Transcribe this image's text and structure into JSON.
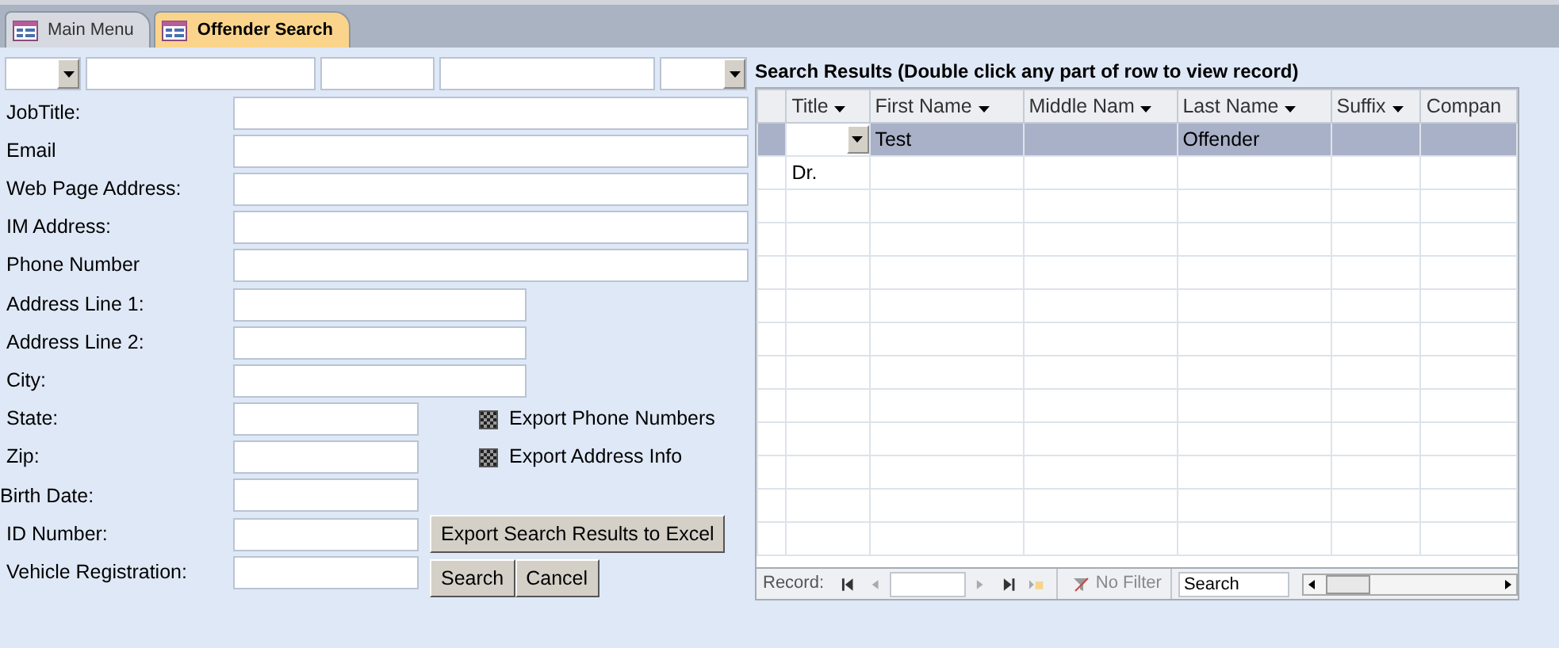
{
  "tabs": [
    {
      "label": "Main Menu",
      "selected": false
    },
    {
      "label": "Offender Search",
      "selected": true
    }
  ],
  "top_fields": [
    {
      "kind": "combo"
    },
    {
      "kind": "text"
    },
    {
      "kind": "text"
    },
    {
      "kind": "text"
    },
    {
      "kind": "combo"
    }
  ],
  "fields": [
    {
      "label": "JobTitle:",
      "kind": "long"
    },
    {
      "label": "Email",
      "kind": "long"
    },
    {
      "label": "Web Page Address:",
      "kind": "long"
    },
    {
      "label": "IM Address:",
      "kind": "long"
    },
    {
      "label": "Phone Number",
      "kind": "long"
    },
    {
      "label": "Address Line 1:",
      "kind": "medium"
    },
    {
      "label": "Address Line 2:",
      "kind": "medium"
    },
    {
      "label": "City:",
      "kind": "medium"
    },
    {
      "label": "State:",
      "kind": "short"
    },
    {
      "label": "Zip:",
      "kind": "short"
    },
    {
      "label": "Birth Date:",
      "kind": "short"
    },
    {
      "label": "ID Number:",
      "kind": "short"
    },
    {
      "label": "Vehicle Registration:",
      "kind": "short"
    }
  ],
  "checkboxes": [
    {
      "label": "Export Phone Numbers",
      "indeterminate": true
    },
    {
      "label": "Export Address Info",
      "indeterminate": true
    }
  ],
  "export_button": "Export Search Results to Excel",
  "buttons": [
    "Search",
    "Cancel"
  ],
  "results": {
    "title": "Search Results (Double click any part of row to view record)",
    "columns": [
      "Title",
      "First Name",
      "Middle Nam",
      "Last Name",
      "Suffix",
      "Compan"
    ],
    "rows": [
      {
        "cells": [
          "",
          "Test",
          "",
          "Offender",
          "",
          ""
        ],
        "selected": true
      },
      {
        "cells": [
          "Dr.",
          "",
          "",
          "",
          "",
          ""
        ],
        "selected": false
      }
    ],
    "navigation": {
      "label": "Record:",
      "filter": "No Filter",
      "search_placeholder": "Search"
    }
  }
}
